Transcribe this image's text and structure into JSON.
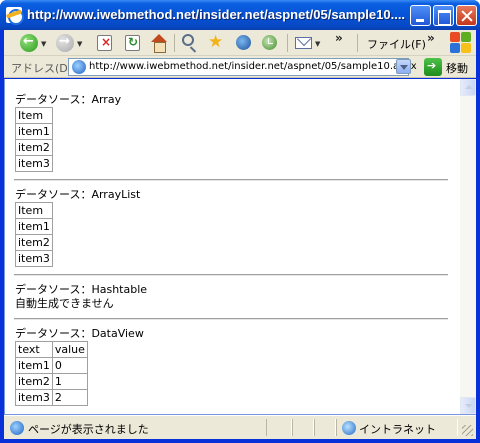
{
  "window": {
    "title": "http://www.iwebmethod.net/insider.net/aspnet/05/sample10...."
  },
  "toolbar": {
    "file_menu": "ファイル(F)",
    "chevron": "»"
  },
  "address_bar": {
    "label": "アドレス(D)",
    "url": "http://www.iwebmethod.net/insider.net/aspnet/05/sample10.aspx",
    "go_label": "移動"
  },
  "sections": [
    {
      "title": "データソース：Array",
      "header": [
        "Item"
      ],
      "rows": [
        [
          "item1"
        ],
        [
          "item2"
        ],
        [
          "item3"
        ]
      ]
    },
    {
      "title": "データソース：ArrayList",
      "header": [
        "Item"
      ],
      "rows": [
        [
          "item1"
        ],
        [
          "item2"
        ],
        [
          "item3"
        ]
      ]
    },
    {
      "title": "データソース：Hashtable",
      "message": "自動生成できません"
    },
    {
      "title": "データソース：DataView",
      "header": [
        "text",
        "value"
      ],
      "rows": [
        [
          "item1",
          "0"
        ],
        [
          "item2",
          "1"
        ],
        [
          "item3",
          "2"
        ]
      ]
    }
  ],
  "status_bar": {
    "text": "ページが表示されました",
    "zone": "イントラネット"
  }
}
